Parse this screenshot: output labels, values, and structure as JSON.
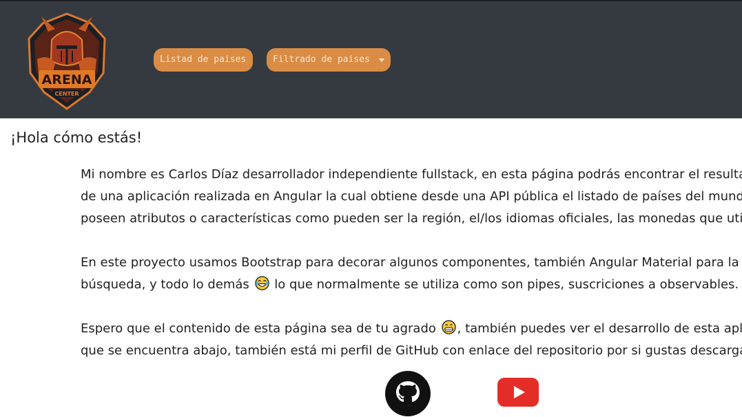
{
  "brand": {
    "logo_icon": "arena-center-knight-logo",
    "logo_text_top": "ARENA",
    "logo_text_bottom": "CENTER"
  },
  "nav": {
    "listado_label": "Listad de paises",
    "filtrado_label": "Filtrado de paises",
    "accent_color": "#db8c44",
    "navbar_color": "#343a40"
  },
  "main": {
    "greeting": "¡Hola cómo estás!",
    "p1": [
      "Mi nombre es Carlos Díaz desarrollador independiente fullstack, en esta página podrás encontrar el resultado",
      "de una aplicación realizada en Angular la cual obtiene desde una API pública el listado de países del mundo,",
      "poseen atributos o características como pueden ser la región, el/los idiomas oficiales, las monedas que utilizan"
    ],
    "p2_line1": "En este proyecto usamos Bootstrap para decorar algunos componentes, también Angular Material para la barra de",
    "p2_line2_before": "búsqueda, y todo lo demás",
    "p2_line2_after": "lo que normalmente se utiliza como son pipes, suscriciones a observables.",
    "p3_line1_before": "Espero que el contenido de esta página sea de tu agrado",
    "p3_line1_after": ", también puedes ver el desarrollo de esta aplicación",
    "p3_line2": "que se encuentra abajo, también está mi perfil de GitHub con enlace del repositorio por si gustas descargarla.",
    "emoji_laugh": "laughing-tears-emoji-icon",
    "emoji_grin": "grinning-face-emoji-icon"
  },
  "social": {
    "github_icon": "github-icon",
    "youtube_icon": "youtube-icon"
  }
}
